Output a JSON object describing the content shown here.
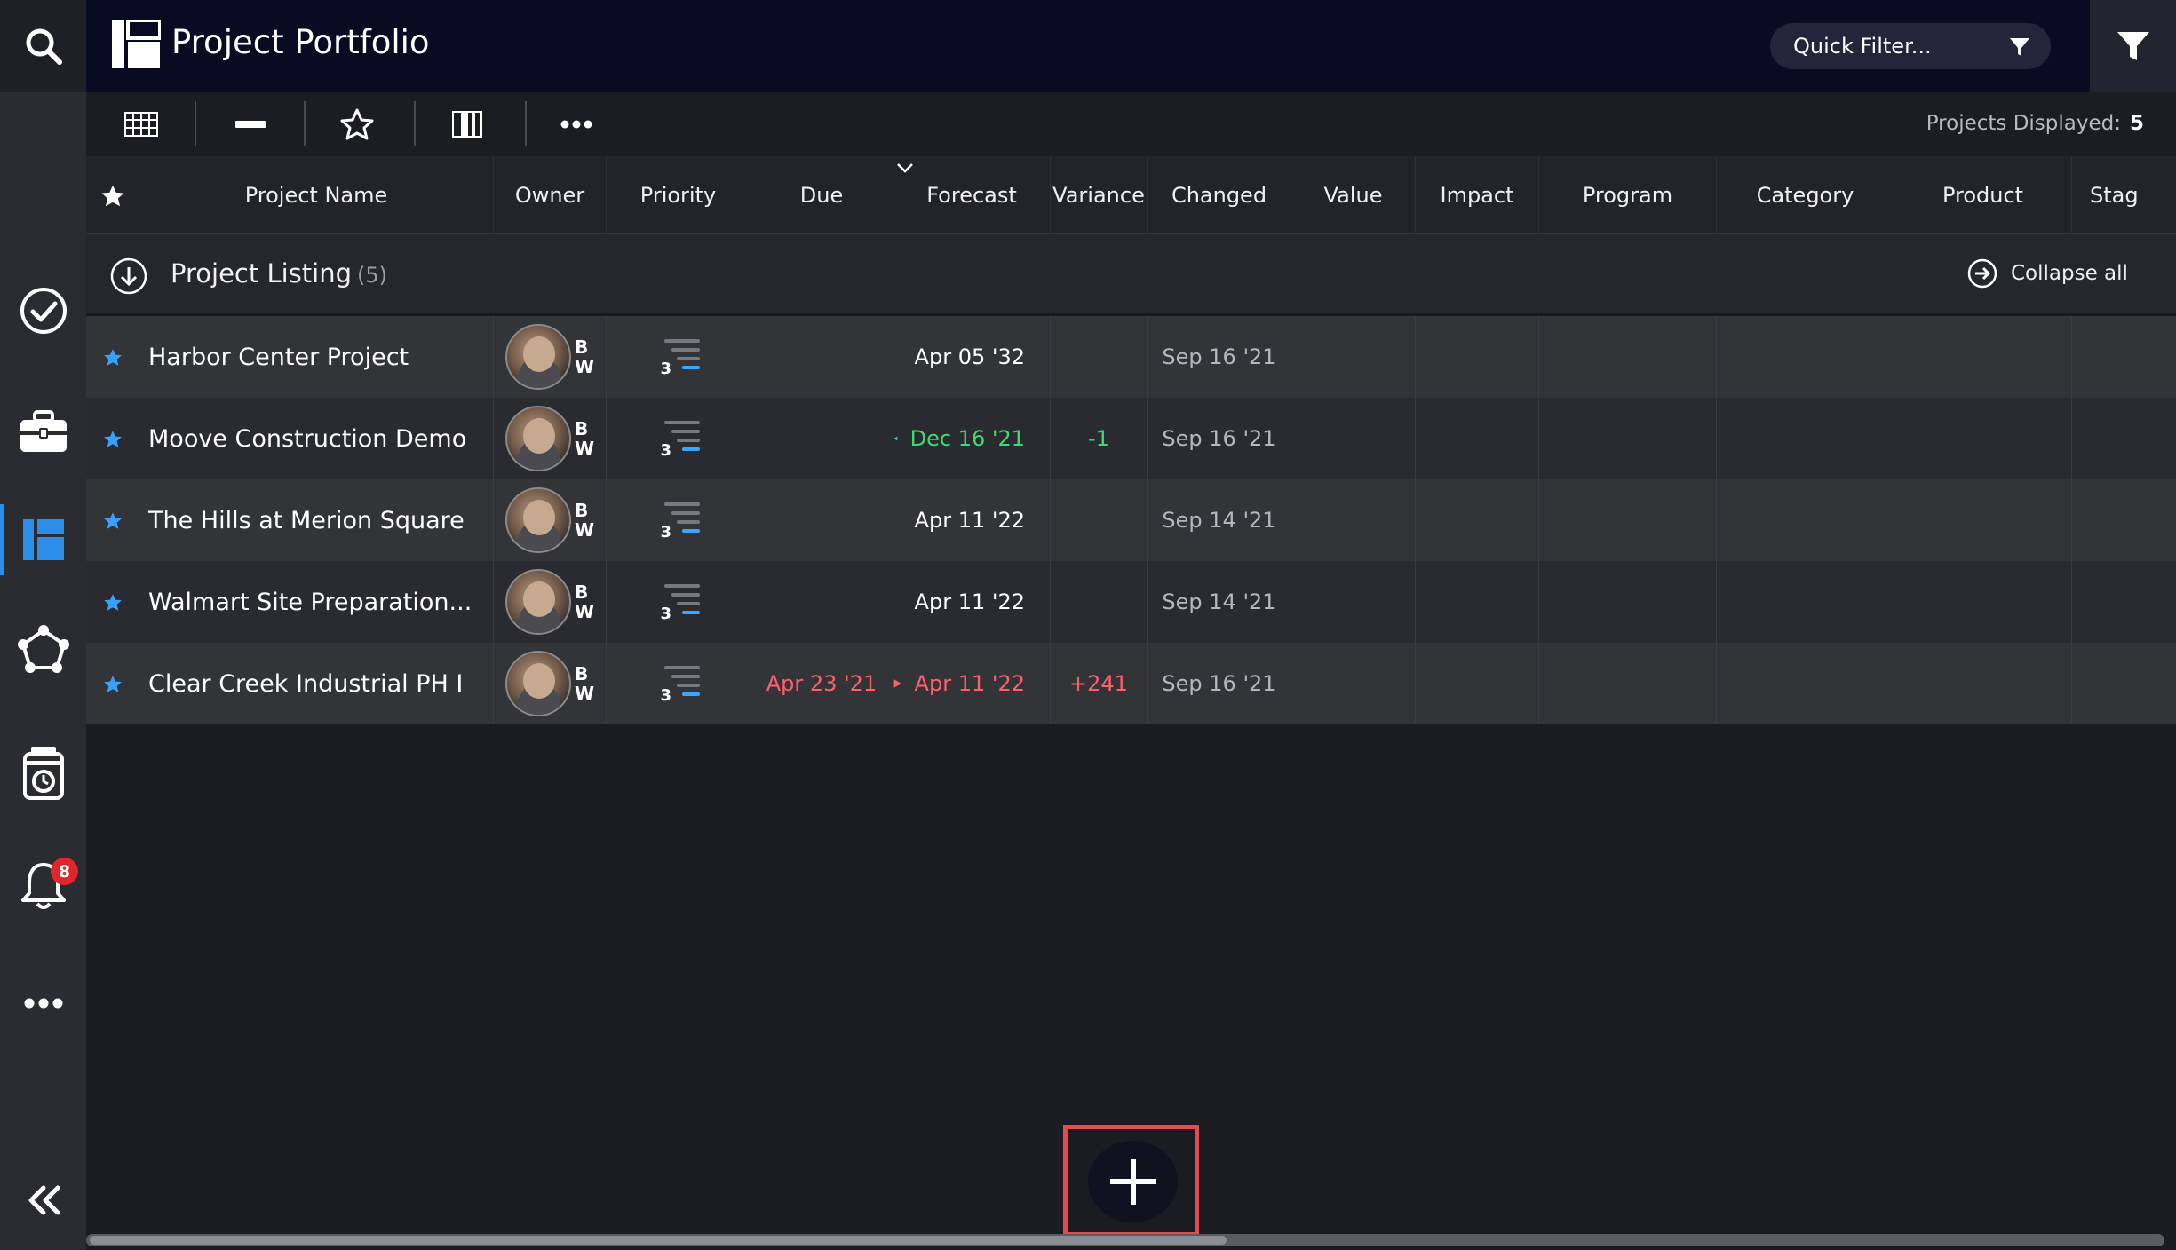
{
  "app": {
    "title": "Project Portfolio",
    "quick_filter_placeholder": "Quick Filter...",
    "projects_displayed_label": "Projects Displayed:",
    "projects_displayed_count": "5"
  },
  "sidebar": {
    "notifications_count": "8",
    "active_item": "portfolio"
  },
  "columns": [
    "Project Name",
    "Owner",
    "Priority",
    "Due",
    "Forecast",
    "Variance",
    "Changed",
    "Value",
    "Impact",
    "Program",
    "Category",
    "Product",
    "Stag"
  ],
  "sort_column": "Due",
  "group": {
    "title": "Project Listing",
    "count": "(5)",
    "collapse_label": "Collapse all"
  },
  "rows": [
    {
      "name": "Harbor Center Project",
      "owner_initials": [
        "B",
        "W"
      ],
      "priority": "3",
      "due": "",
      "forecast": "Apr 05 '32",
      "forecast_trend": "none",
      "variance": "",
      "changed": "Sep 16 '21"
    },
    {
      "name": "Moove Construction Demo",
      "owner_initials": [
        "B",
        "W"
      ],
      "priority": "3",
      "due": "",
      "forecast": "Dec 16 '21",
      "forecast_trend": "early",
      "variance": "-1",
      "changed": "Sep 16 '21"
    },
    {
      "name": "The Hills at Merion Square",
      "owner_initials": [
        "B",
        "W"
      ],
      "priority": "3",
      "due": "",
      "forecast": "Apr 11 '22",
      "forecast_trend": "none",
      "variance": "",
      "changed": "Sep 14 '21"
    },
    {
      "name": "Walmart Site Preparation...",
      "owner_initials": [
        "B",
        "W"
      ],
      "priority": "3",
      "due": "",
      "forecast": "Apr 11 '22",
      "forecast_trend": "none",
      "variance": "",
      "changed": "Sep 14 '21"
    },
    {
      "name": "Clear Creek Industrial PH I",
      "owner_initials": [
        "B",
        "W"
      ],
      "priority": "3",
      "due": "Apr 23 '21",
      "forecast": "Apr 11 '22",
      "forecast_trend": "late",
      "variance": "+241",
      "changed": "Sep 16 '21"
    }
  ],
  "colors": {
    "accent": "#2c8ee8",
    "early": "#3ddc6e",
    "late": "#ff5f6d",
    "badge": "#e0262b",
    "fab_highlight": "#e64a4a"
  },
  "icons": {
    "search": "search-icon",
    "tasks": "check-circle-icon",
    "projects": "briefcase-icon",
    "portfolio": "portfolio-icon",
    "network": "network-icon",
    "timesheet": "timesheet-icon",
    "notifications": "bell-icon",
    "more": "more-icon",
    "collapse": "double-chevron-left-icon",
    "add": "plus-icon"
  }
}
